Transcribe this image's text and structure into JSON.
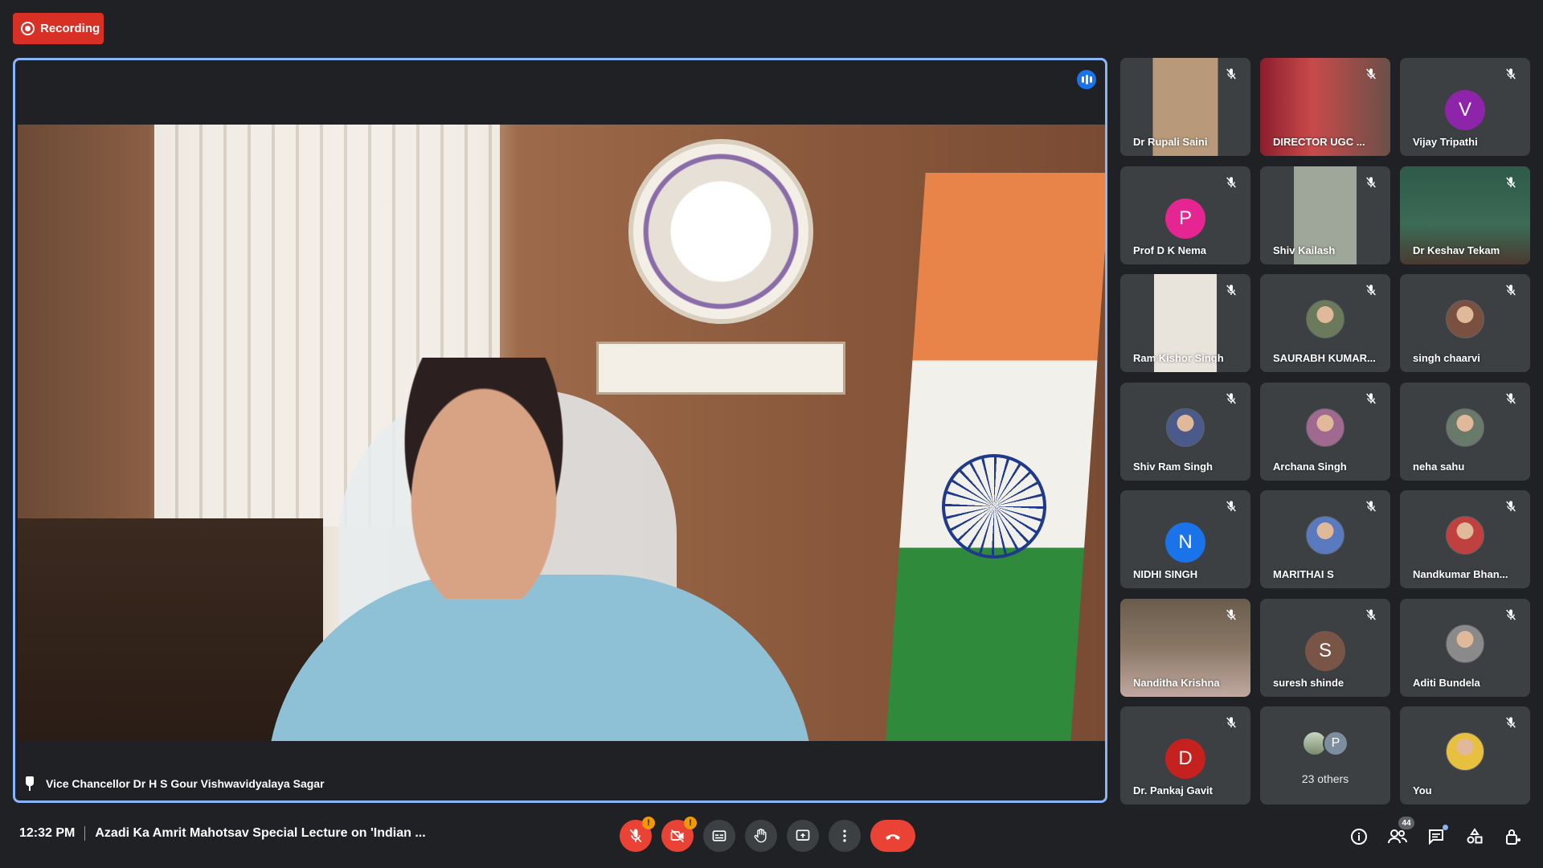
{
  "recording": {
    "label": "Recording",
    "color": "#d93025"
  },
  "main_speaker": {
    "name": "Vice Chancellor Dr H S Gour Vishwavidyalaya Sagar"
  },
  "accent": "#8ab4f8",
  "participants": [
    {
      "name": "Dr Rupali Saini",
      "type": "video"
    },
    {
      "name": "DIRECTOR UGC ...",
      "type": "video"
    },
    {
      "name": "Vijay Tripathi",
      "type": "letter",
      "letter": "V",
      "color": "#8e24aa"
    },
    {
      "name": "Prof D K Nema",
      "type": "letter",
      "letter": "P",
      "color": "#e52592"
    },
    {
      "name": "Shiv Kailash",
      "type": "video"
    },
    {
      "name": "Dr Keshav Tekam",
      "type": "video"
    },
    {
      "name": "Ram Kishor Singh",
      "type": "video"
    },
    {
      "name": "SAURABH KUMAR...",
      "type": "photo"
    },
    {
      "name": "singh chaarvi",
      "type": "photo"
    },
    {
      "name": "Shiv Ram Singh",
      "type": "photo"
    },
    {
      "name": "Archana Singh",
      "type": "photo"
    },
    {
      "name": "neha sahu",
      "type": "photo"
    },
    {
      "name": "NIDHI SINGH",
      "type": "letter",
      "letter": "N",
      "color": "#1a73e8"
    },
    {
      "name": "MARITHAI S",
      "type": "photo"
    },
    {
      "name": "Nandkumar Bhan...",
      "type": "photo"
    },
    {
      "name": "Nanditha Krishna",
      "type": "video"
    },
    {
      "name": "suresh shinde",
      "type": "letter",
      "letter": "S",
      "color": "#795548"
    },
    {
      "name": "Aditi Bundela",
      "type": "photo"
    },
    {
      "name": "Dr. Pankaj Gavit",
      "type": "letter",
      "letter": "D",
      "color": "#c5221f"
    },
    {
      "name": "23 others",
      "type": "others",
      "letter": "P"
    },
    {
      "name": "You",
      "type": "photo"
    }
  ],
  "bottom": {
    "time": "12:32 PM",
    "meeting_title": "Azadi Ka Amrit Mahotsav Special Lecture on 'Indian ...",
    "participant_count": "44",
    "warn_badge": "!"
  }
}
